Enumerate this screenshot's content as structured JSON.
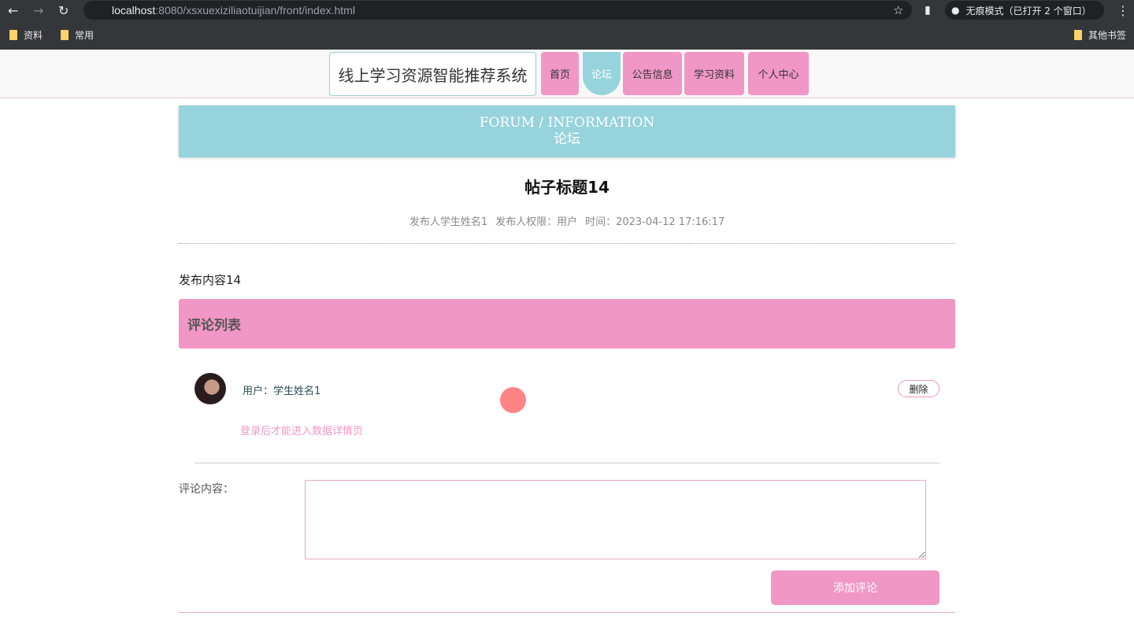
{
  "browser": {
    "url_host": "localhost",
    "url_path": ":8080/xsxuexiziliaotuijian/front/index.html",
    "incognito": "无痕模式（已打开 2 个窗口）",
    "bookmarks": [
      "资料",
      "常用"
    ],
    "other_bookmarks": "其他书签"
  },
  "nav": {
    "site_title": "线上学习资源智能推荐系统",
    "items": [
      "首页",
      "论坛",
      "公告信息",
      "学习资料",
      "个人中心"
    ],
    "active": "论坛"
  },
  "banner": {
    "en": "FORUM / INFORMATION",
    "cn": "论坛"
  },
  "post": {
    "title": "帖子标题14",
    "author": "发布人学生姓名1",
    "role": "发布人权限：用户",
    "time": "时间：2023-04-12 17:16:17",
    "content": "发布内容14"
  },
  "comments": {
    "header": "评论列表",
    "items": [
      {
        "user": "用户：学生姓名1",
        "delete_label": "删除",
        "content": "登录后才能进入数据详情页"
      }
    ]
  },
  "form": {
    "label": "评论内容：",
    "value": "",
    "submit": "添加评论"
  },
  "colors": {
    "pink": "#f097c5",
    "teal": "#96d3dc"
  }
}
